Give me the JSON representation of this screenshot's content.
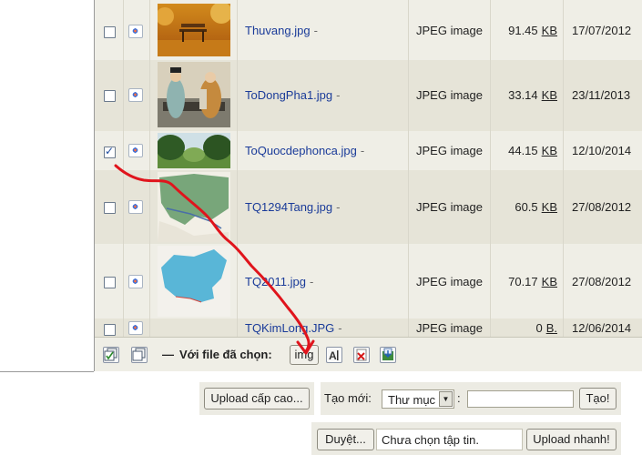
{
  "files": [
    {
      "name": "Thuvang.jpg",
      "type": "JPEG image",
      "size": "91.45",
      "unit": "KB",
      "date": "17/07/2012",
      "checked": false
    },
    {
      "name": "ToDongPha1.jpg",
      "type": "JPEG image",
      "size": "33.14",
      "unit": "KB",
      "date": "23/11/2013",
      "checked": false
    },
    {
      "name": "ToQuocdephonca.jpg",
      "type": "JPEG image",
      "size": "44.15",
      "unit": "KB",
      "date": "12/10/2014",
      "checked": true
    },
    {
      "name": "TQ1294Tang.jpg",
      "type": "JPEG image",
      "size": "60.5",
      "unit": "KB",
      "date": "27/08/2012",
      "checked": false
    },
    {
      "name": "TQ2011.jpg",
      "type": "JPEG image",
      "size": "70.17",
      "unit": "KB",
      "date": "27/08/2012",
      "checked": false
    },
    {
      "name": "TQKimLong.JPG",
      "type": "JPEG image",
      "size": "0",
      "unit": "B.",
      "date": "12/06/2014",
      "checked": false
    }
  ],
  "name_separator": "-",
  "bulk": {
    "label": "Với file đã chọn:",
    "dash": "—",
    "img_button": "img"
  },
  "upload": {
    "advanced_button": "Upload cấp cao...",
    "create_label": "Tạo mới:",
    "create_select": "Thư mục",
    "colon": ":",
    "create_button": "Tạo!",
    "browse_button": "Duyệt...",
    "no_file_text": "Chưa chọn tập tin.",
    "quick_upload_button": "Upload nhanh!"
  },
  "colors": {
    "link": "#1a3b99",
    "annotation": "#e0141c"
  }
}
